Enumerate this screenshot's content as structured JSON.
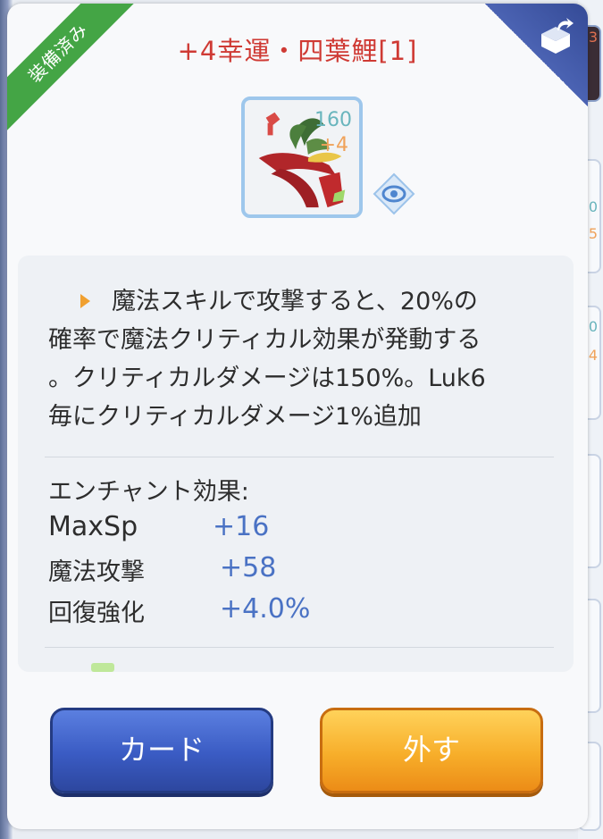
{
  "header": {
    "equipped_ribbon": "装備済み",
    "item_title": "+4幸運・四葉鯉[1]"
  },
  "item": {
    "level": "160",
    "refine": "+4"
  },
  "description": {
    "lines": [
      "魔法スキルで攻撃すると、20%の",
      "確率で魔法クリティカル効果が発動する",
      "。クリティカルダメージは150%。Luk6",
      "毎にクリティカルダメージ1%追加"
    ]
  },
  "enchant": {
    "heading": "エンチャント効果:",
    "rows": [
      {
        "name": "MaxSp",
        "value": "+16"
      },
      {
        "name": "魔法攻撃",
        "value": "+58"
      },
      {
        "name": "回復強化",
        "value": "+4.0%"
      }
    ]
  },
  "buttons": {
    "card": "カード",
    "remove": "外す"
  },
  "side_panel": {
    "numbers": [
      "3",
      "0",
      "5",
      "0",
      "4"
    ]
  },
  "colors": {
    "title": "#cf3a34",
    "ribbon": "#44a545",
    "enchant_value": "#4a72c4",
    "card_button": "#3a5bc3",
    "remove_button": "#f7ae2a"
  },
  "icons": [
    "share-icon",
    "eye-icon",
    "item-image",
    "arrow-icon"
  ]
}
